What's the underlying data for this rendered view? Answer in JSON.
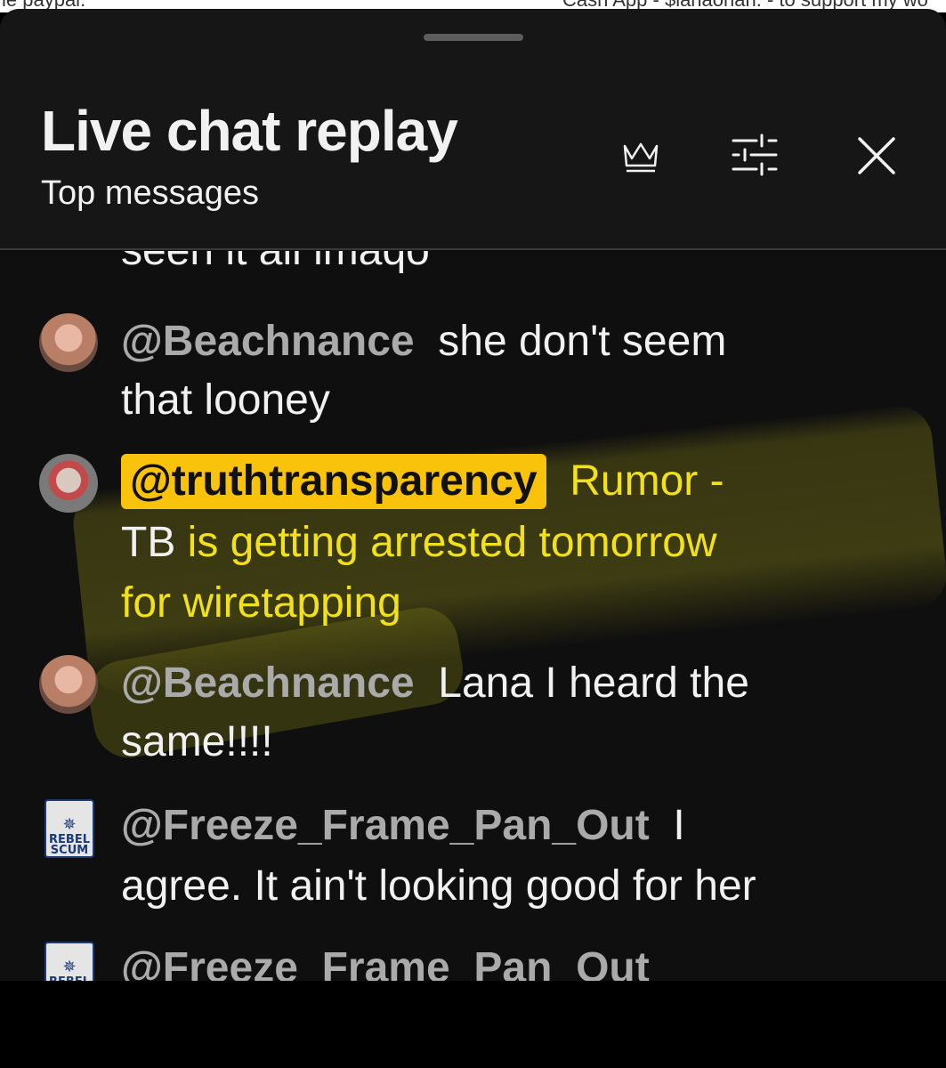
{
  "top_strip": {
    "left_text": "le paypal.",
    "right_text": "Cash App - $lanaohan. - to support my wo"
  },
  "header": {
    "title": "Live chat replay",
    "subtitle": "Top messages",
    "icons": [
      "crown-icon",
      "tune-icon",
      "close-icon"
    ]
  },
  "chat": {
    "cut_off_text": "seen it all imaqo",
    "messages": [
      {
        "author": "@Beachnance",
        "line1": "she don't seem",
        "line2": "that looney",
        "highlighted_author": false
      },
      {
        "author": "@truthtransparency",
        "line1": "Rumor -",
        "line2_prefix": "TB",
        "line2_rest": " is getting arrested tomorrow",
        "line3": "for wiretapping",
        "highlighted_author": true
      },
      {
        "author": "@Beachnance",
        "line1": "Lana I heard the",
        "line2": "same!!!!",
        "highlighted_author": false
      },
      {
        "author": "@Freeze_Frame_Pan_Out",
        "line1": "I",
        "line2": "agree. It ain't looking good for her",
        "highlighted_author": false
      },
      {
        "author": "@Freeze_Frame_Pan_Out",
        "line1": "",
        "highlighted_author": false
      }
    ],
    "rebel_avatar_text": [
      "REBEL",
      "SCUM"
    ]
  },
  "colors": {
    "background": "#0f0f0f",
    "header_bg": "#161616",
    "author_gray": "#aaaaaa",
    "highlight_chip": "#f9c30c",
    "highlighted_text": "#f2e11a"
  }
}
